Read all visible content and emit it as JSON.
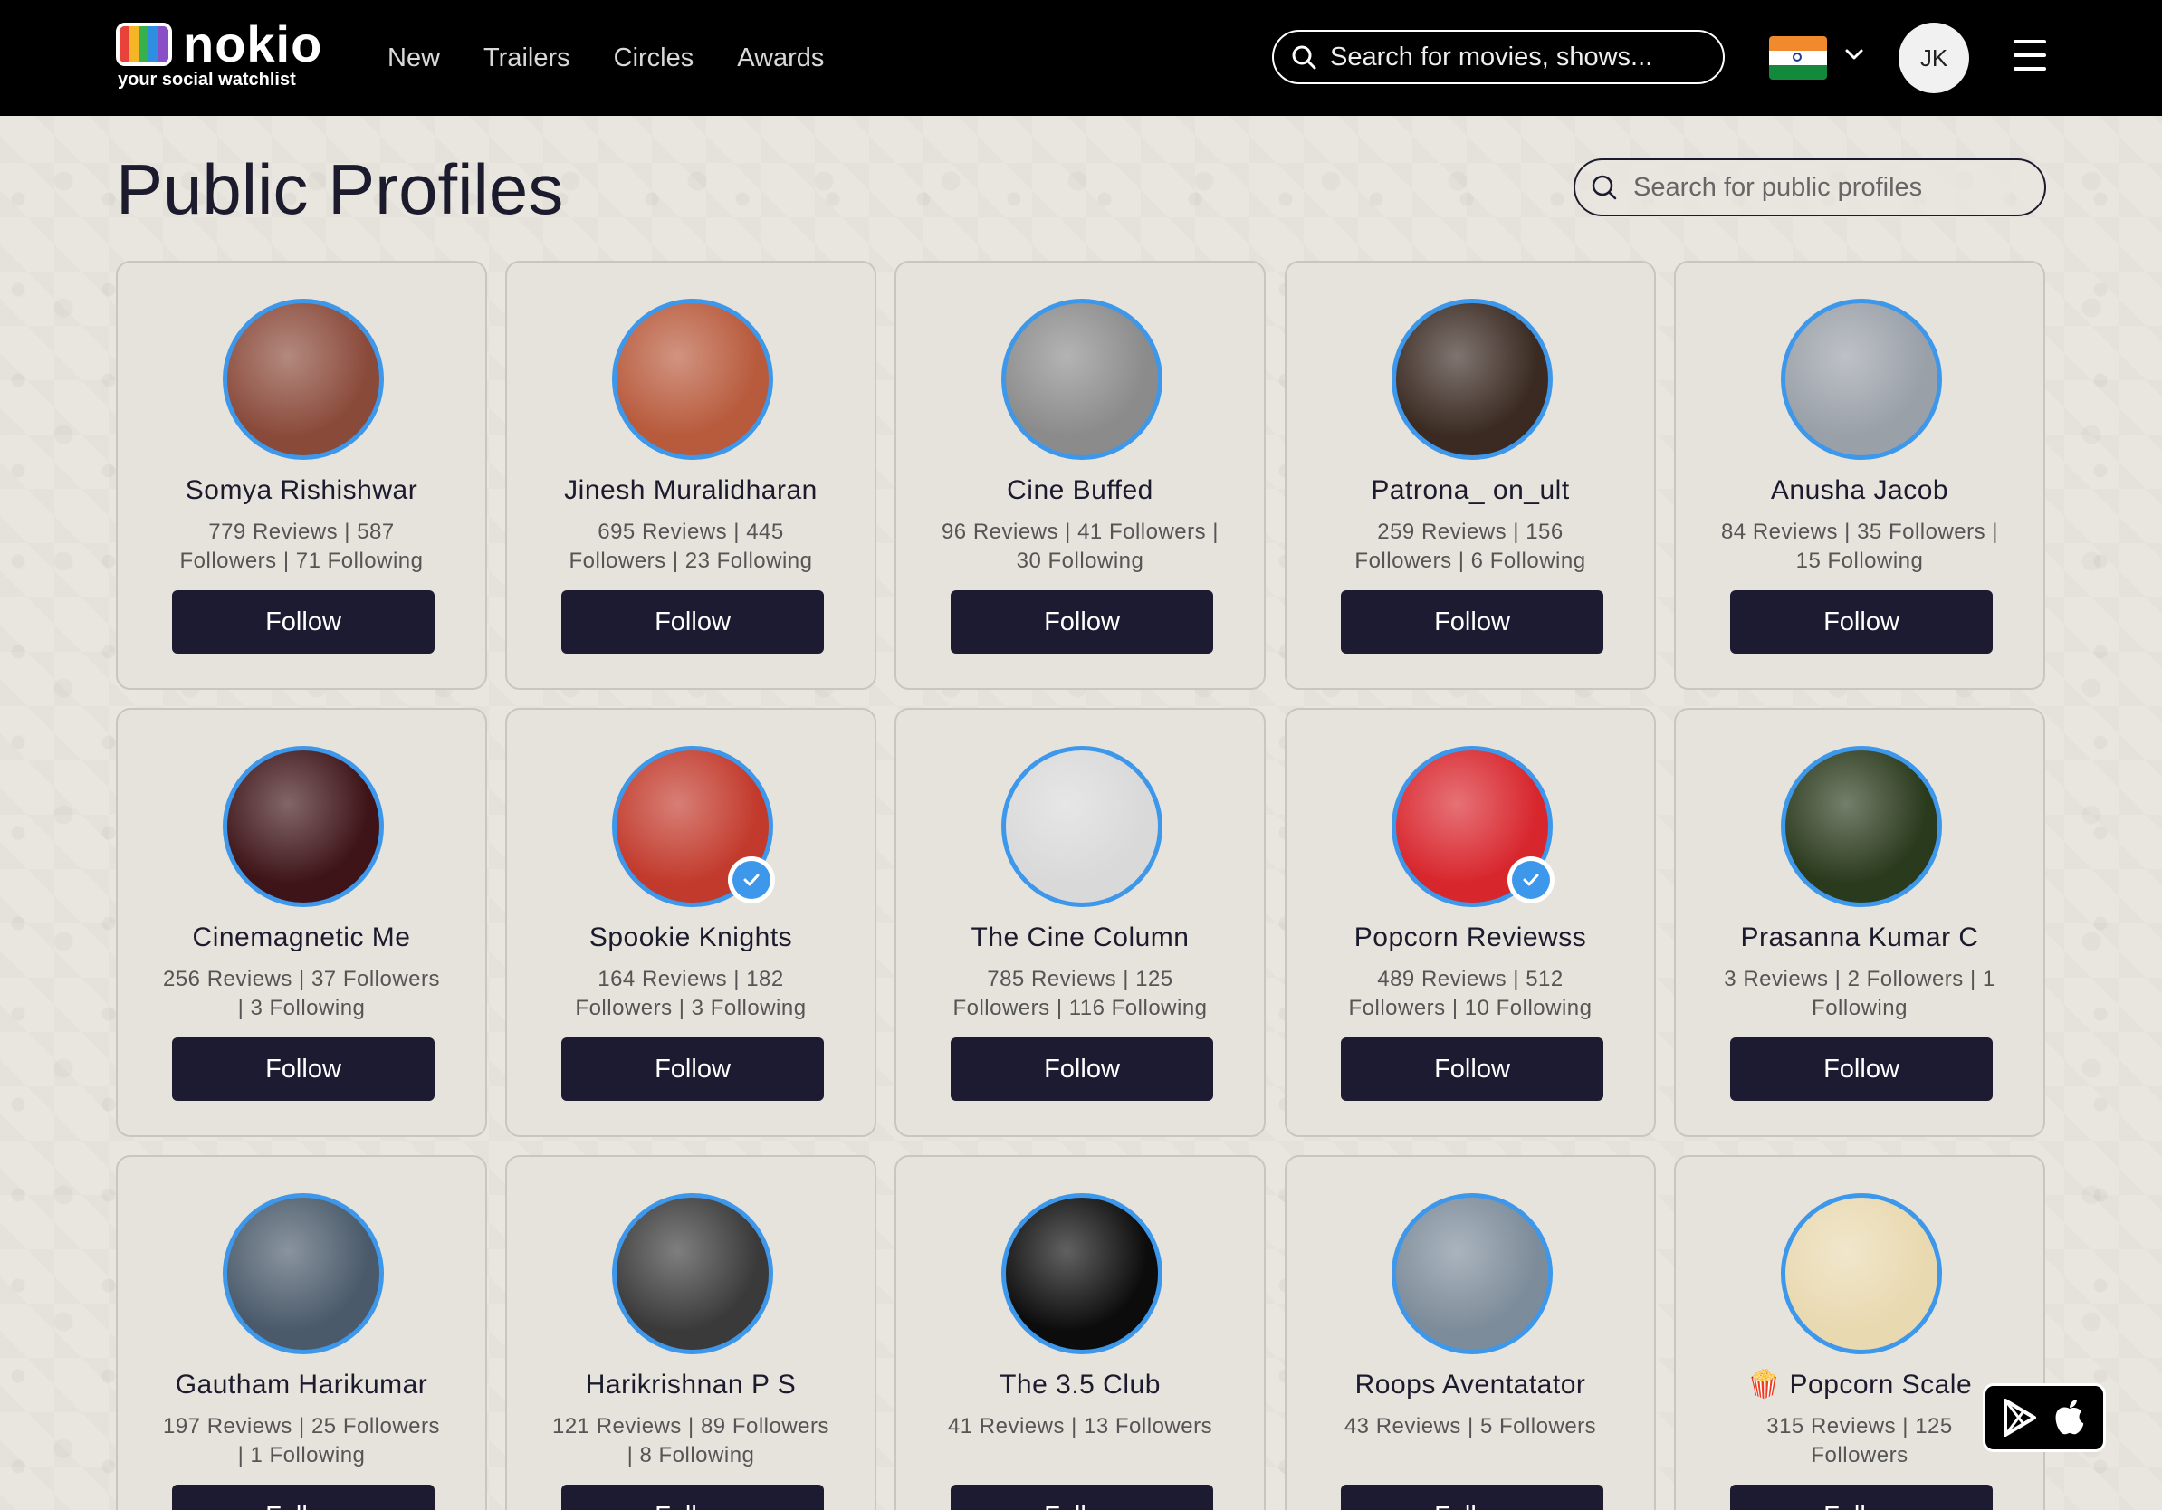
{
  "brand": {
    "name": "nokio",
    "tagline": "your social watchlist"
  },
  "nav": [
    "New",
    "Trailers",
    "Circles",
    "Awards"
  ],
  "top_search": {
    "placeholder": "Search for movies, shows..."
  },
  "user": {
    "initials": "JK"
  },
  "page": {
    "title": "Public Profiles",
    "search_placeholder": "Search for public profiles"
  },
  "follow_label": "Follow",
  "profiles": [
    {
      "name": "Somya Rishishwar",
      "stats": "779 Reviews | 587 Followers | 71 Following",
      "verified": false,
      "avatar_color": "#8a4a3a"
    },
    {
      "name": "Jinesh Muralidharan",
      "stats": "695 Reviews | 445 Followers | 23 Following",
      "verified": false,
      "avatar_color": "#b85a3c"
    },
    {
      "name": "Cine Buffed",
      "stats": "96 Reviews | 41 Followers | 30 Following",
      "verified": false,
      "avatar_color": "#8b8b8b"
    },
    {
      "name": "Patrona_ on_ult",
      "stats": "259 Reviews | 156 Followers | 6 Following",
      "verified": false,
      "avatar_color": "#3a2a22"
    },
    {
      "name": "Anusha Jacob",
      "stats": "84 Reviews | 35 Followers | 15 Following",
      "verified": false,
      "avatar_color": "#9aa0a8"
    },
    {
      "name": "Cinemagnetic Me",
      "stats": "256 Reviews | 37 Followers | 3 Following",
      "verified": false,
      "avatar_color": "#3e1418"
    },
    {
      "name": "Spookie Knights",
      "stats": "164 Reviews | 182 Followers | 3 Following",
      "verified": true,
      "avatar_color": "#c23a2c"
    },
    {
      "name": "The Cine Column",
      "stats": "785 Reviews | 125 Followers | 116 Following",
      "verified": false,
      "avatar_color": "#d9d9d9"
    },
    {
      "name": "Popcorn Reviewss",
      "stats": "489 Reviews | 512 Followers | 10 Following",
      "verified": true,
      "avatar_color": "#d8262d"
    },
    {
      "name": "Prasanna Kumar C",
      "stats": "3 Reviews | 2 Followers | 1 Following",
      "verified": false,
      "avatar_color": "#2a3a1c"
    },
    {
      "name": "Gautham Harikumar",
      "stats": "197 Reviews | 25 Followers | 1 Following",
      "verified": false,
      "avatar_color": "#4a5a6a"
    },
    {
      "name": "Harikrishnan P S",
      "stats": "121 Reviews | 89 Followers | 8 Following",
      "verified": false,
      "avatar_color": "#3a3a3a"
    },
    {
      "name": "The 3.5 Club",
      "stats": "41 Reviews | 13 Followers",
      "verified": false,
      "avatar_color": "#0c0c0c"
    },
    {
      "name": "Roops Aventatator",
      "stats": "43 Reviews | 5 Followers",
      "verified": false,
      "avatar_color": "#7d8c9a"
    },
    {
      "name": "🍿 Popcorn Scale",
      "stats": "315 Reviews | 125 Followers",
      "verified": false,
      "avatar_color": "#e9d9b0"
    }
  ],
  "colors": {
    "accent": "#3d97ea",
    "button": "#1d1b32",
    "header": "#000000"
  }
}
